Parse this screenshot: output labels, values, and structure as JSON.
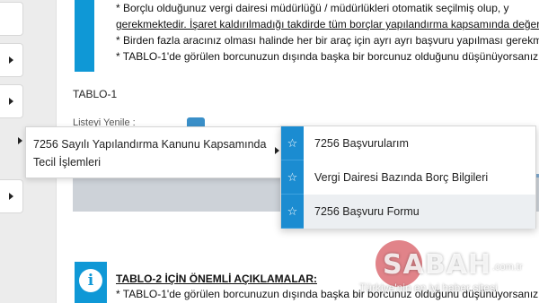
{
  "notice": {
    "lines": [
      "* Borçlu olduğunuz vergi dairesi müdürlüğü / müdürlükleri otomatik seçilmiş olup, y",
      "gerekmektedir. İşaret kaldırılmadığı takdirde tüm borçlar yapılandırma kapsamında değer",
      "* Birden fazla aracınız olması halinde her bir araç için ayrı ayrı başvuru yapılması gerekme",
      "* TABLO-1'de görülen borcunuzun dışında başka bir borcunuz olduğunu düşünüyorsanız, T"
    ]
  },
  "section": {
    "tablo1_label": "TABLO-1",
    "listeyi_label": "Listeyi Yenile :"
  },
  "menu": {
    "l1_line1": "7256 Sayılı Yapılandırma Kanunu Kapsamında",
    "l1_line2": "Tecil İşlemleri",
    "submenu": [
      {
        "label": "7256 Başvurularım",
        "icon": "star-icon"
      },
      {
        "label": "Vergi Dairesi Bazında Borç Bilgileri",
        "icon": "star-icon"
      },
      {
        "label": "7256 Başvuru Formu",
        "icon": "star-icon"
      }
    ]
  },
  "bottom_notice": {
    "title": "TABLO-2 İÇİN ÖNEMLİ AÇIKLAMALAR:",
    "line": "* TABLO-1'de görülen borcunuzun dışında başka bir borcunuz olduğunu düşünüyorsanız, T"
  },
  "watermark": {
    "brand": "SABAH",
    "tld": ".com.tr",
    "slogan": "Türkiye'nin en iyi haber sitesi"
  },
  "colors": {
    "accent": "#0f98d6",
    "submenu_icon_bg": "#1b8cd1"
  }
}
